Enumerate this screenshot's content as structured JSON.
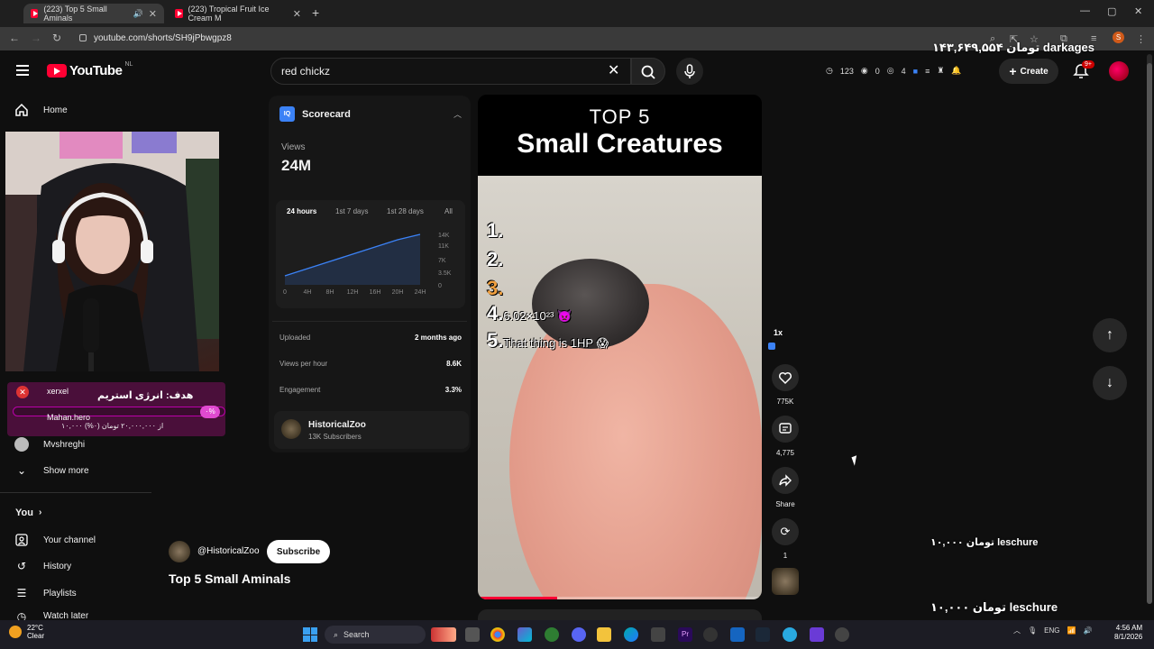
{
  "browser": {
    "tabs": [
      {
        "title": "(223) Top 5 Small Aminals"
      },
      {
        "title": "(223) Tropical Fruit Ice Cream M"
      }
    ],
    "url": "youtube.com/shorts/SH9jPbwgpz8"
  },
  "overlays": {
    "top_right": "۱۴۳,۶۴۹,۵۵۴ تومان darkages",
    "mid_right": "۱۰,۰۰۰ تومان leschure",
    "bottom_right": "۱۰,۰۰۰ تومان leschure"
  },
  "header": {
    "logo_text": "YouTube",
    "logo_region": "NL",
    "search_value": "red chickz",
    "stats": {
      "clock_count": "123",
      "eye1": "0",
      "eye2": "4"
    },
    "create_label": "Create",
    "notif_badge": "9+"
  },
  "sidebar": {
    "home_label": "Home",
    "items_partial": [
      {
        "label": "Mvshreghi"
      }
    ],
    "show_more_label": "Show more",
    "you_label": "You",
    "you_items": [
      {
        "label": "Your channel"
      },
      {
        "label": "History"
      },
      {
        "label": "Playlists"
      },
      {
        "label": "Watch later"
      }
    ]
  },
  "donation": {
    "user1": "xerxel",
    "goal_text": "هدف: انرژی استریم",
    "user2": "Mahan.hero",
    "amount_text": "۱۰,۰۰۰ از ۲۰,۰۰۰,۰۰۰ تومان (۰%)",
    "pct": "۰%"
  },
  "scorecard": {
    "logo_text": "IQ",
    "title": "Scorecard",
    "views_label": "Views",
    "views_value": "24M",
    "tabs": [
      "24 hours",
      "1st 7 days",
      "1st 28 days",
      "All"
    ],
    "y_ticks": [
      "14K",
      "11K",
      "7K",
      "3.5K",
      "0"
    ],
    "x_ticks": [
      "0",
      "4H",
      "8H",
      "12H",
      "16H",
      "20H",
      "24H"
    ],
    "rows": [
      {
        "label": "Uploaded",
        "value": "2 months ago"
      },
      {
        "label": "Views per hour",
        "value": "8.6K"
      },
      {
        "label": "Engagement",
        "value": "3.3%"
      }
    ],
    "channel_name": "HistoricalZoo",
    "channel_subs": "13K Subscribers"
  },
  "chart_data": {
    "type": "line",
    "x": [
      0,
      4,
      8,
      12,
      16,
      20,
      24
    ],
    "series": [
      {
        "values": [
          2500,
          4500,
          6500,
          8500,
          10500,
          12500,
          14000
        ]
      }
    ],
    "xlabel": "",
    "ylabel": "",
    "ylim": [
      0,
      14000
    ],
    "xlim": [
      0,
      24
    ]
  },
  "video": {
    "title_line1": "TOP 5",
    "title_line2": "Small Creatures",
    "ranks": [
      {
        "num": "1.",
        "text": ""
      },
      {
        "num": "2.",
        "text": ""
      },
      {
        "num": "3.",
        "text": ""
      },
      {
        "num": "4.",
        "text": "6.02×10²³ 👿"
      },
      {
        "num": "5.",
        "text": "That thing is 1HP 😱"
      }
    ],
    "progress_pct": 28
  },
  "actions": {
    "speed_label": "1x",
    "like_count": "775K",
    "comment_count": "4,775",
    "share_label": "Share",
    "remix_count": "1"
  },
  "channel": {
    "handle": "@HistoricalZoo",
    "subscribe_label": "Subscribe",
    "short_title": "Top 5 Small Aminals"
  },
  "taskbar": {
    "temp": "22°C",
    "weather": "Clear",
    "search_label": "Search",
    "lang": "ENG",
    "time": "4:56 AM",
    "date": "8/1/2026"
  }
}
